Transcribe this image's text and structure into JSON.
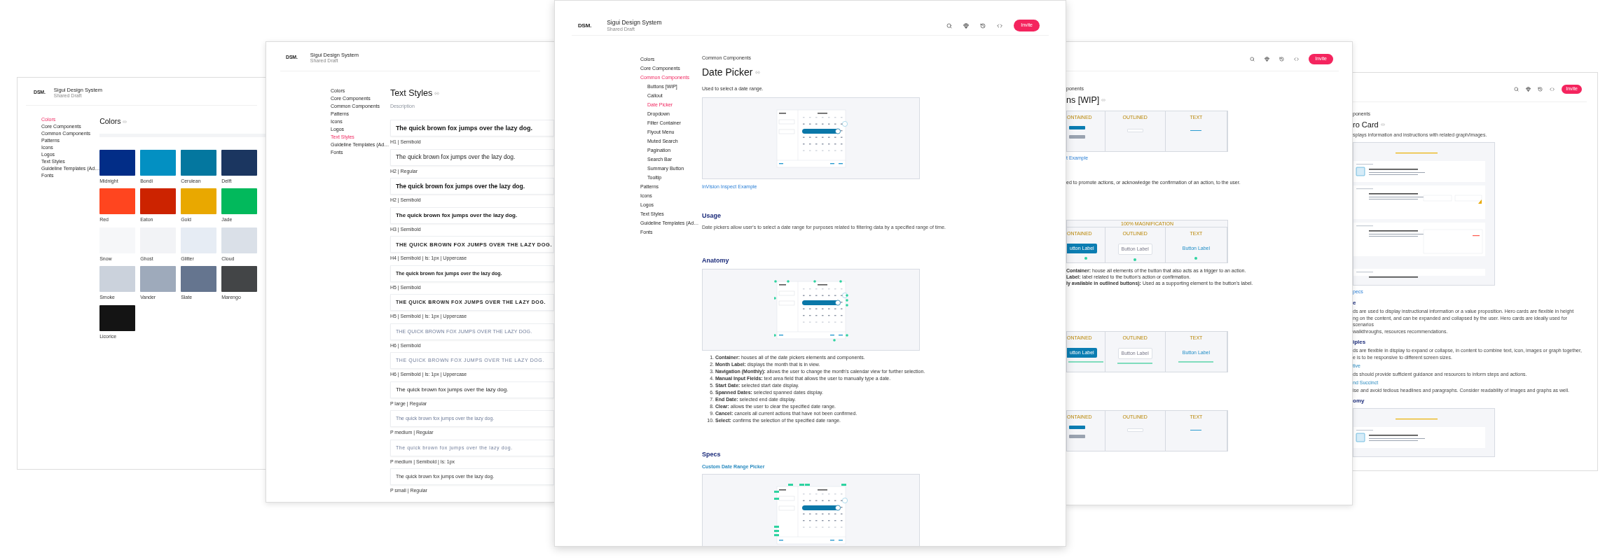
{
  "colors_page": {
    "logo": "DSM.",
    "title": "Sigui Design System",
    "subtitle": "Shared Draft",
    "nav": [
      {
        "label": "Colors",
        "selected": true
      },
      {
        "label": "Core Components",
        "selected": false
      },
      {
        "label": "Common Components",
        "selected": false
      },
      {
        "label": "Patterns",
        "selected": false
      },
      {
        "label": "Icons",
        "selected": false
      },
      {
        "label": "Logos",
        "selected": false
      },
      {
        "label": "Text Styles",
        "selected": false
      },
      {
        "label": "Guideline Templates (Ad…",
        "selected": false
      },
      {
        "label": "Fonts",
        "selected": false
      }
    ],
    "heading": "Colors",
    "swatches": [
      {
        "name": "Midnight",
        "color": "#022d87"
      },
      {
        "name": "Bondi",
        "color": "#0390c2"
      },
      {
        "name": "Cerulean",
        "color": "#04779f"
      },
      {
        "name": "Delft",
        "color": "#1b3660"
      },
      {
        "name": "Red",
        "color": "#ff451f"
      },
      {
        "name": "Eaton",
        "color": "#cc2300"
      },
      {
        "name": "Gold",
        "color": "#e9a800"
      },
      {
        "name": "Jade",
        "color": "#02b95c"
      },
      {
        "name": "Snow",
        "color": "#f6f7f9"
      },
      {
        "name": "Ghost",
        "color": "#f2f3f6"
      },
      {
        "name": "Glitter",
        "color": "#e6ecf4"
      },
      {
        "name": "Cloud",
        "color": "#dae0e8"
      },
      {
        "name": "Smoke",
        "color": "#cbd2dc"
      },
      {
        "name": "Vander",
        "color": "#9eaabb"
      },
      {
        "name": "Slate",
        "color": "#65758f"
      },
      {
        "name": "Marengo",
        "color": "#434547"
      },
      {
        "name": "Licorice",
        "color": "#141414"
      }
    ]
  },
  "text_styles_page": {
    "logo": "DSM.",
    "title": "Sigui Design System",
    "subtitle": "Shared Draft",
    "nav": [
      {
        "label": "Colors",
        "selected": false
      },
      {
        "label": "Core Components",
        "selected": false
      },
      {
        "label": "Common Components",
        "selected": false
      },
      {
        "label": "Patterns",
        "selected": false
      },
      {
        "label": "Icons",
        "selected": false
      },
      {
        "label": "Logos",
        "selected": false
      },
      {
        "label": "Text Styles",
        "selected": true
      },
      {
        "label": "Guideline Templates (Ad…",
        "selected": false
      },
      {
        "label": "Fonts",
        "selected": false
      }
    ],
    "heading": "Text Styles",
    "description_placeholder": "Description",
    "samples": [
      {
        "kind": "h1",
        "text": "The quick brown fox jumps over the lazy dog.",
        "label": "H1 | Semibold"
      },
      {
        "kind": "h2",
        "text": "The quick brown fox jumps over the lazy dog.",
        "label": "H2 | Regular"
      },
      {
        "kind": "h2b",
        "text": "The quick brown fox jumps over the lazy dog.",
        "label": "H2 | Semibold"
      },
      {
        "kind": "h3",
        "text": "The quick brown fox jumps over the lazy dog.",
        "label": "H3 | Semibold"
      },
      {
        "kind": "h4",
        "text": "THE QUICK BROWN FOX JUMPS OVER THE LAZY DOG.",
        "label": "H4 | Semibold | ls: 1px | Uppercase"
      },
      {
        "kind": "h5",
        "text": "The quick brown fox jumps over the lazy dog.",
        "label": "H5 | Semibold"
      },
      {
        "kind": "h5caps",
        "text": "THE QUICK BROWN FOX JUMPS OVER THE LAZY DOG.",
        "label": "H5 | Semibold | ls: 1px | Uppercase"
      },
      {
        "kind": "h6",
        "text": "THE QUICK BROWN FOX JUMPS OVER THE LAZY DOG.",
        "label": "H6 | Semibold"
      },
      {
        "kind": "h6caps",
        "text": "THE QUICK BROWN FOX JUMPS OVER THE LAZY DOG.",
        "label": "H6 | Semibold | ls: 1px | Uppercase"
      },
      {
        "kind": "plarge",
        "text": "The quick brown fox jumps over the lazy dog.",
        "label": "P large | Regular"
      },
      {
        "kind": "pmedium",
        "text": "The quick brown fox jumps over the lazy dog.",
        "label": "P medium | Regular"
      },
      {
        "kind": "pmediumspaced",
        "text": "The quick brown fox jumps over the lazy dog.",
        "label": "P medium | Semibold | ls: 1px"
      },
      {
        "kind": "psmall",
        "text": "The quick brown fox jumps over the lazy dog.",
        "label": "P small | Regular"
      }
    ]
  },
  "date_picker_page": {
    "logo": "DSM.",
    "title": "Sigui Design System",
    "subtitle": "Shared Draft",
    "invite": "Invite",
    "nav": [
      {
        "label": "Colors",
        "selected": false
      },
      {
        "label": "Core Components",
        "selected": false
      },
      {
        "label": "Common Components",
        "selected": true,
        "children": [
          {
            "label": "Buttons [WIP]",
            "selected": false
          },
          {
            "label": "Callout",
            "selected": false
          },
          {
            "label": "Date Picker",
            "selected": true
          },
          {
            "label": "Dropdown",
            "selected": false
          },
          {
            "label": "Filter Container",
            "selected": false
          },
          {
            "label": "Flyout Menu",
            "selected": false
          },
          {
            "label": "Muted Search",
            "selected": false
          },
          {
            "label": "Pagination",
            "selected": false
          },
          {
            "label": "Search Bar",
            "selected": false
          },
          {
            "label": "Summary Button",
            "selected": false
          },
          {
            "label": "Tooltip",
            "selected": false
          }
        ]
      },
      {
        "label": "Patterns",
        "selected": false
      },
      {
        "label": "Icons",
        "selected": false
      },
      {
        "label": "Logos",
        "selected": false
      },
      {
        "label": "Text Styles",
        "selected": false
      },
      {
        "label": "Guideline Templates (Ad…",
        "selected": false
      },
      {
        "label": "Fonts",
        "selected": false
      }
    ],
    "breadcrumb": "Common Components",
    "heading": "Date Picker",
    "description": "Used to select a date range.",
    "example_link": "InVision Inspect Example",
    "usage": {
      "heading": "Usage",
      "text": "Date pickers allow user's to select a date range for purposes related to filtering data by a specified range of time."
    },
    "anatomy": {
      "heading": "Anatomy",
      "items": [
        {
          "number": "1.",
          "text": "**Container:** houses all of the date pickers elements and components."
        },
        {
          "number": "2.",
          "text": "**Month Label:** displays the month that is in view."
        },
        {
          "number": "3.",
          "text": "**Navigation (Monthly):** allows the user to change the month's calendar view for further selection."
        },
        {
          "number": "4.",
          "text": "**Manual Input Fields:** text area field that allows the user to manually type a date."
        },
        {
          "number": "5.",
          "text": "**Start Date:** selected start date display."
        },
        {
          "number": "6.",
          "text": "**Spanned Dates:** selected spanned dates display."
        },
        {
          "number": "7.",
          "text": "**End Date:** selected end date display."
        },
        {
          "number": "8.",
          "text": "**Clear:** allows the user to clear the specified date range."
        },
        {
          "number": "9.",
          "text": "**Cancel:** cancels all current actions that have not been confirmed."
        },
        {
          "number": "10.",
          "text": "**Select:** confirms the selection of the specified date range."
        }
      ]
    },
    "specs": {
      "heading": "Specs",
      "subheading": "Custom Date Range Picker"
    }
  },
  "buttons_page": {
    "invite": "Invite",
    "breadcrumb": "ponents",
    "heading": "ns [WIP]",
    "tables": [
      {
        "kind": "states",
        "columns": [
          "ONTAINED",
          "OUTLINED",
          "TEXT"
        ]
      }
    ],
    "example_link": "t Example",
    "description": "ed to promote actions, or acknowledge the confirmation of an action, to the user.",
    "anatomy_table": {
      "kind": "anatomy",
      "banner": "100% MAGNIFICATION",
      "columns": [
        "ONTAINED",
        "OUTLINED",
        "TEXT"
      ],
      "labels": [
        "utton Label",
        "Button Label",
        "Button Label"
      ]
    },
    "anatomy_items": [
      "**Container:** house all elements of the button that also acts as a trigger to an action.",
      "**Label:** label related to the button's action or confirmation.",
      "**ly available in outlined buttons):** Used as a supporting element to the button's label."
    ],
    "more_tables": [
      {
        "kind": "specs",
        "columns": [
          "ONTAINED",
          "OUTLINED",
          "TEXT"
        ],
        "labels": [
          "utton Label",
          "Button Label",
          "Button Label"
        ]
      },
      {
        "kind": "states",
        "columns": [
          "ONTAINED",
          "OUTLINED",
          "TEXT"
        ]
      }
    ]
  },
  "hero_card_page": {
    "invite": "Invite",
    "breadcrumb": "ponents",
    "heading": "ro Card",
    "description": "splays information and instructions with related graph/images.",
    "specs_link": "pecs",
    "sections": [
      {
        "heading": "e",
        "paragraphs": [
          "ds are used to display instructional information or a value proposition. Hero cards are flexible in height",
          "ng on the content, and can be expanded and collapsed by the user. Hero cards are ideally used for scenarios",
          "walkthroughs, resources recommendations."
        ]
      },
      {
        "heading": "iples",
        "paragraphs": [
          "ds are flexible in display to expand or collapse, in content to combine text, icon, images or graph together,",
          "e is to be responsive to different screen sizes."
        ]
      },
      {
        "subheading": "tive",
        "paragraphs": [
          "ds should provide sufficient guidance and resources to inform steps and actions."
        ]
      },
      {
        "subheading": "nd Succinct",
        "paragraphs": [
          "ise and avoid tedious headlines and paragraphs. Consider readability of images and graphs as well."
        ]
      },
      {
        "heading": "omy"
      }
    ]
  }
}
